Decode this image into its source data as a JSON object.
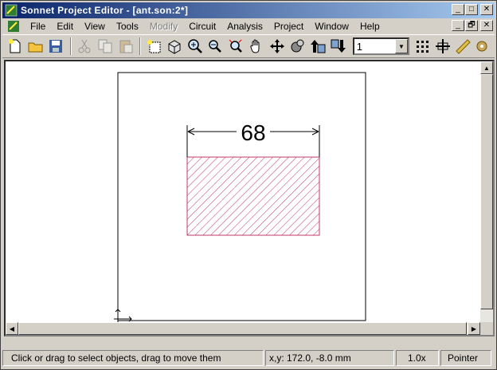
{
  "window": {
    "title": "Sonnet Project Editor - [ant.son:2*]",
    "title_buttons": [
      "_",
      "□",
      "✕"
    ],
    "mdi_buttons": [
      "_",
      "🗗",
      "✕"
    ]
  },
  "menu": {
    "items": [
      {
        "label": "File",
        "enabled": true
      },
      {
        "label": "Edit",
        "enabled": true
      },
      {
        "label": "View",
        "enabled": true
      },
      {
        "label": "Tools",
        "enabled": true
      },
      {
        "label": "Modify",
        "enabled": false
      },
      {
        "label": "Circuit",
        "enabled": true
      },
      {
        "label": "Analysis",
        "enabled": true
      },
      {
        "label": "Project",
        "enabled": true
      },
      {
        "label": "Window",
        "enabled": true
      },
      {
        "label": "Help",
        "enabled": true
      }
    ]
  },
  "toolbar": {
    "level_value": "1",
    "icons": [
      "new-icon",
      "open-icon",
      "save-icon",
      "cut-icon",
      "copy-icon",
      "paste-icon",
      "select-box-icon",
      "3d-view-icon",
      "zoom-in-icon",
      "zoom-out-icon",
      "zoom-fit-icon",
      "pan-hand-icon",
      "move-icon",
      "rotate-icon",
      "level-up-icon",
      "level-down-icon",
      "grid-icon",
      "reference-icon",
      "ruler-icon",
      "tool-icon"
    ]
  },
  "drawing": {
    "dimension_label": "68",
    "colors": {
      "box_outline": "#000000",
      "hatch": "#c0386a",
      "dimension": "#000000"
    }
  },
  "statusbar": {
    "hint": "Click or drag to select objects, drag to move them",
    "coords": "x,y: 172.0, -8.0 mm",
    "zoom": "1.0x",
    "mode": "Pointer"
  }
}
